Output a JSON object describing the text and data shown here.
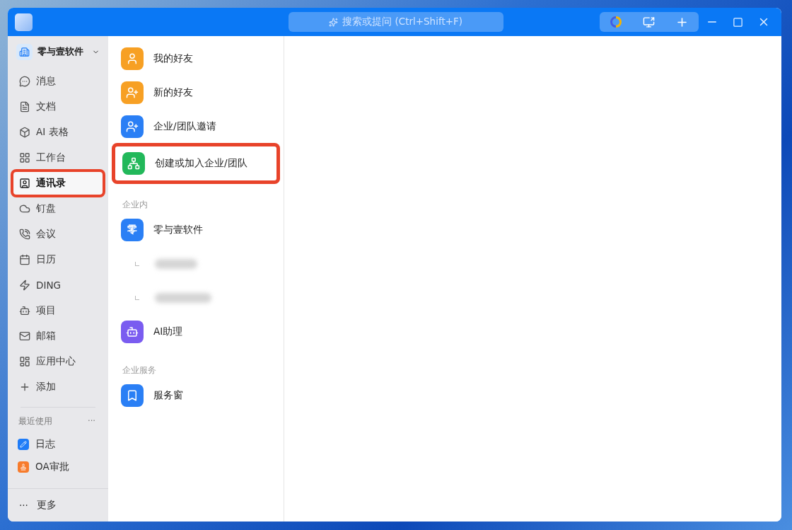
{
  "titlebar": {
    "search": {
      "placeholder": "搜索或提问 (Ctrl+Shift+F)"
    }
  },
  "org": {
    "name": "零与壹软件"
  },
  "nav": [
    {
      "label": "消息",
      "selected": false,
      "highlighted": false
    },
    {
      "label": "文档",
      "selected": false,
      "highlighted": false
    },
    {
      "label": "AI 表格",
      "selected": false,
      "highlighted": false
    },
    {
      "label": "工作台",
      "selected": false,
      "highlighted": false
    },
    {
      "label": "通讯录",
      "selected": true,
      "highlighted": true
    },
    {
      "label": "钉盘",
      "selected": false,
      "highlighted": false
    },
    {
      "label": "会议",
      "selected": false,
      "highlighted": false
    },
    {
      "label": "日历",
      "selected": false,
      "highlighted": false
    },
    {
      "label": "DING",
      "selected": false,
      "highlighted": false
    },
    {
      "label": "项目",
      "selected": false,
      "highlighted": false
    },
    {
      "label": "邮箱",
      "selected": false,
      "highlighted": false
    },
    {
      "label": "应用中心",
      "selected": false,
      "highlighted": false
    },
    {
      "label": "添加",
      "selected": false,
      "highlighted": false
    }
  ],
  "recent": {
    "title": "最近使用",
    "more": "···",
    "items": [
      {
        "label": "日志",
        "color": "#1f7cf7"
      },
      {
        "label": "OA审批",
        "color": "#f77b2c"
      }
    ]
  },
  "more": {
    "icon": "···",
    "label": "更多"
  },
  "contacts": [
    {
      "kind": "item",
      "label": "我的好友",
      "color": "#f7a024",
      "highlighted": false
    },
    {
      "kind": "item",
      "label": "新的好友",
      "color": "#f7a024",
      "highlighted": false
    },
    {
      "kind": "item",
      "label": "企业/团队邀请",
      "color": "#2a7ff5",
      "highlighted": false
    },
    {
      "kind": "item",
      "label": "创建或加入企业/团队",
      "color": "#22b85a",
      "highlighted": true
    },
    {
      "kind": "section",
      "label": "企业内"
    },
    {
      "kind": "org",
      "label": "零与壹软件",
      "badge": "零",
      "color": "#2a7ff5",
      "children": [
        {
          "kind": "redacted"
        },
        {
          "kind": "redacted"
        }
      ]
    },
    {
      "kind": "item",
      "label": "AI助理",
      "color": "#7a5cf0",
      "highlighted": false
    },
    {
      "kind": "section",
      "label": "企业服务"
    },
    {
      "kind": "item",
      "label": "服务窗",
      "color": "#2a7ff5",
      "highlighted": false
    }
  ]
}
